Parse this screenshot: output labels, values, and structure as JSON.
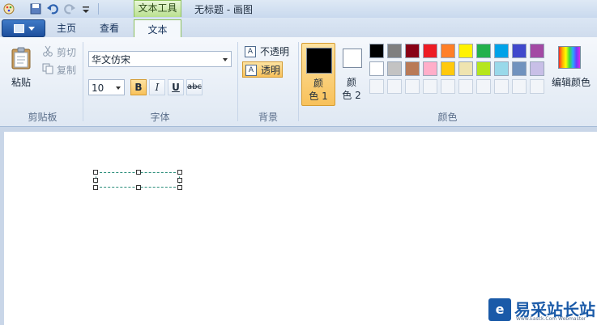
{
  "title_bar": {
    "context_tab": "文本工具",
    "window_title": "无标题 - 画图"
  },
  "tabs": [
    {
      "label": "主页"
    },
    {
      "label": "查看"
    },
    {
      "label": "文本"
    }
  ],
  "clipboard": {
    "paste": "粘贴",
    "cut": "剪切",
    "copy": "复制",
    "group": "剪贴板"
  },
  "font": {
    "family": "华文仿宋",
    "size": "10",
    "bold": "B",
    "italic": "I",
    "underline": "U",
    "strike": "abc",
    "group": "字体"
  },
  "background": {
    "opaque": "不透明",
    "transparent": "透明",
    "group": "背景"
  },
  "colors": {
    "color1_label": "颜色 1",
    "color1_line1": "颜",
    "color1_line2": "色 1",
    "color2_line1": "颜",
    "color2_line2": "色 2",
    "color1": "#000000",
    "color2": "#ffffff",
    "palette": [
      [
        "#000000",
        "#7f7f7f",
        "#880015",
        "#ed1c24",
        "#ff7f27",
        "#fff200",
        "#22b14c",
        "#00a2e8",
        "#3f48cc",
        "#a349a4"
      ],
      [
        "#ffffff",
        "#c3c3c3",
        "#b97a57",
        "#ffaec9",
        "#ffc90e",
        "#efe4b0",
        "#b5e61d",
        "#99d9ea",
        "#7092be",
        "#c8bfe7"
      ],
      [
        "",
        "",
        "",
        "",
        "",
        "",
        "",
        "",
        "",
        ""
      ]
    ],
    "edit": "编辑颜色",
    "group": "颜色"
  },
  "watermark": {
    "text": "易采站长站",
    "sub": "Www.Easck.Com Webmaster"
  }
}
